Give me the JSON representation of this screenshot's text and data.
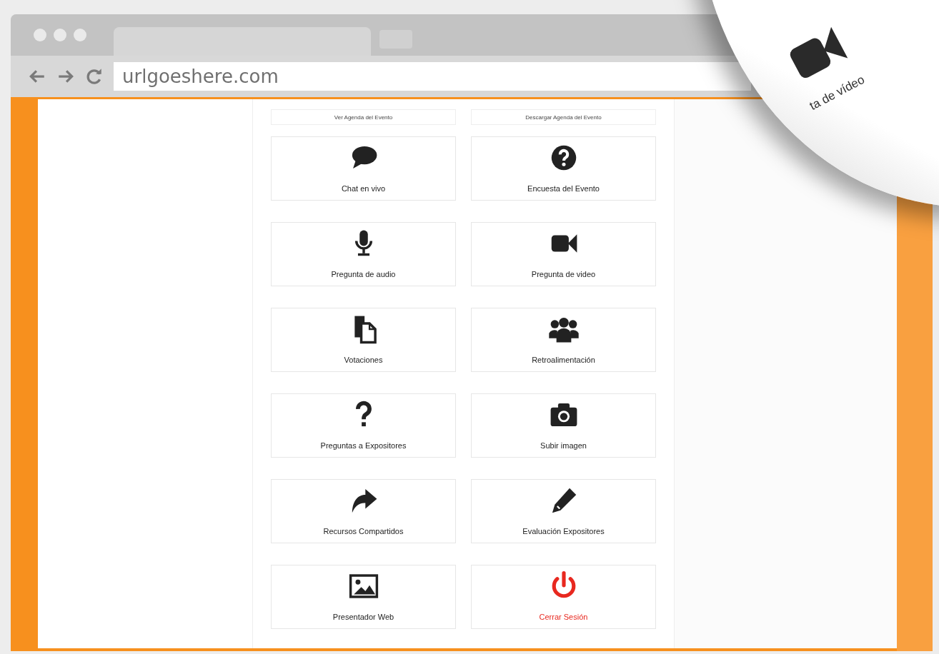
{
  "browser": {
    "url": "urlgoeshere.com"
  },
  "agenda_buttons": [
    "Ver Agenda del Evento",
    "Descargar Agenda del Evento"
  ],
  "tiles": [
    {
      "label": "Chat en vivo",
      "kind": "normal"
    },
    {
      "label": "Encuesta del Evento",
      "kind": "normal"
    },
    {
      "label": "Pregunta de audio",
      "kind": "normal"
    },
    {
      "label": "Pregunta de video",
      "kind": "normal"
    },
    {
      "label": "Votaciones",
      "kind": "normal"
    },
    {
      "label": "Retroalimentación",
      "kind": "normal"
    },
    {
      "label": "Preguntas a Expositores",
      "kind": "normal"
    },
    {
      "label": "Subir imagen",
      "kind": "normal"
    },
    {
      "label": "Recursos Compartidos",
      "kind": "normal"
    },
    {
      "label": "Evaluación Expositores",
      "kind": "normal"
    },
    {
      "label": "Presentador Web",
      "kind": "normal"
    },
    {
      "label": "Cerrar Sesión",
      "kind": "danger"
    }
  ],
  "page_curl": {
    "label": "ta de vídeo"
  }
}
